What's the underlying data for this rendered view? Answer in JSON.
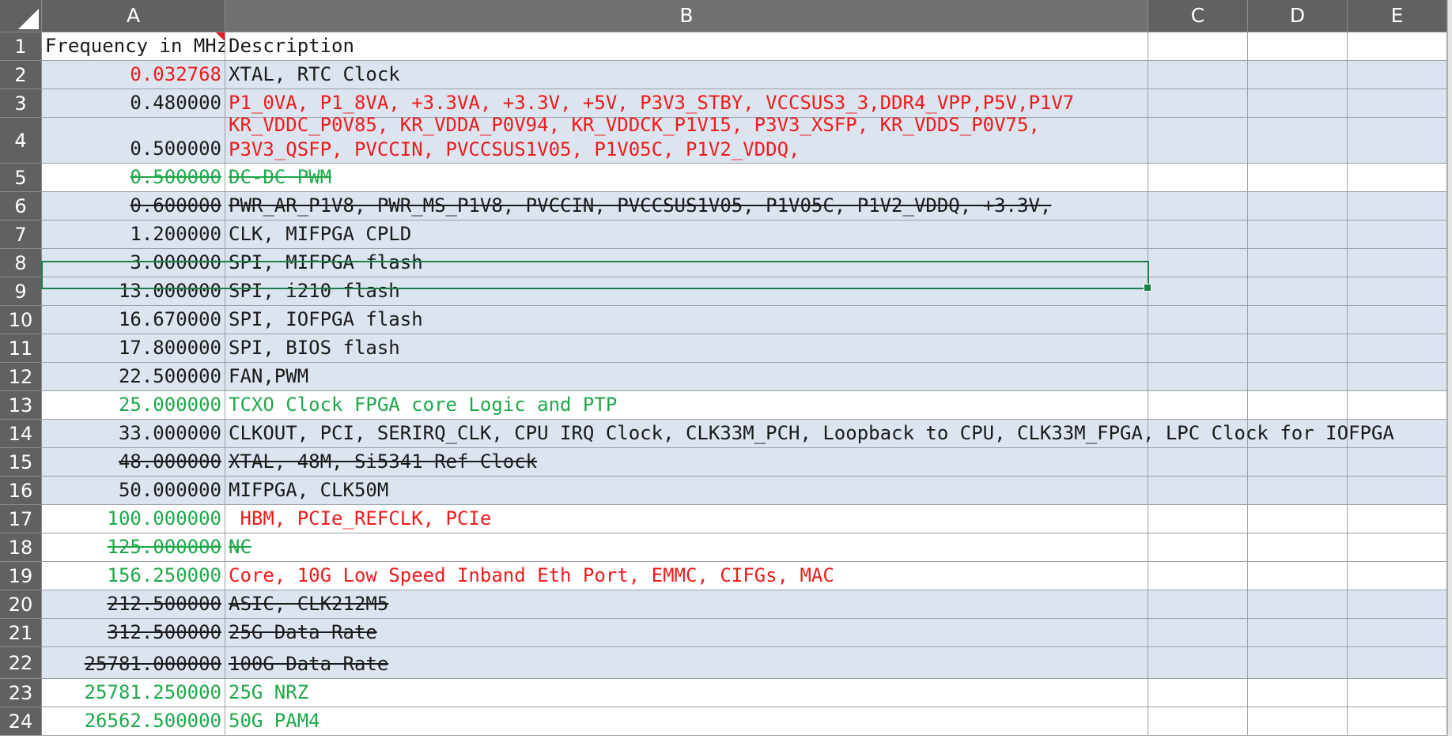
{
  "columns": {
    "A": "A",
    "B": "B",
    "C": "C",
    "D": "D",
    "E": "E"
  },
  "rows": [
    {
      "num": "1",
      "a": "Frequency in MHz",
      "b": "Description",
      "a_color": "black",
      "b_color": "black",
      "strike": false,
      "fill": false
    },
    {
      "num": "2",
      "a": "0.032768",
      "b": "XTAL, RTC Clock",
      "a_color": "red",
      "b_color": "black",
      "strike": false,
      "fill": true
    },
    {
      "num": "3",
      "a": "0.480000",
      "b": "P1_0VA, P1_8VA, +3.3VA, +3.3V, +5V, P3V3_STBY, VCCSUS3_3,DDR4_VPP,P5V,P1V7",
      "a_color": "black",
      "b_color": "red",
      "strike": false,
      "fill": true
    },
    {
      "num": "4",
      "a": "0.500000",
      "b": "KR_VDDC_P0V85, KR_VDDA_P0V94, KR_VDDCK_P1V15, P3V3_XSFP, KR_VDDS_P0V75, P3V3_QSFP, PVCCIN, PVCCSUS1V05, P1V05C, P1V2_VDDQ,",
      "a_color": "black",
      "b_color": "red",
      "strike": false,
      "fill": true
    },
    {
      "num": "5",
      "a": "0.500000",
      "b": "DC-DC PWM",
      "a_color": "green",
      "b_color": "green",
      "strike": true,
      "fill": false
    },
    {
      "num": "6",
      "a": "0.600000",
      "b": "PWR_AR_P1V8, PWR_MS_P1V8, PVCCIN, PVCCSUS1V05, P1V05C, P1V2_VDDQ, +3.3V,",
      "a_color": "black",
      "b_color": "black",
      "strike": true,
      "fill": true
    },
    {
      "num": "7",
      "a": "1.200000",
      "b": "CLK, MIFPGA CPLD",
      "a_color": "black",
      "b_color": "black",
      "strike": false,
      "fill": true
    },
    {
      "num": "8",
      "a": "3.000000",
      "b": "SPI, MIFPGA flash",
      "a_color": "black",
      "b_color": "black",
      "strike": false,
      "fill": true
    },
    {
      "num": "9",
      "a": "13.000000",
      "b": "SPI, i210 flash",
      "a_color": "black",
      "b_color": "black",
      "strike": false,
      "fill": true
    },
    {
      "num": "10",
      "a": "16.670000",
      "b": "SPI, IOFPGA flash",
      "a_color": "black",
      "b_color": "black",
      "strike": false,
      "fill": true
    },
    {
      "num": "11",
      "a": "17.800000",
      "b": "SPI, BIOS flash",
      "a_color": "black",
      "b_color": "black",
      "strike": false,
      "fill": true
    },
    {
      "num": "12",
      "a": "22.500000",
      "b": "FAN,PWM",
      "a_color": "black",
      "b_color": "black",
      "strike": false,
      "fill": true
    },
    {
      "num": "13",
      "a": "25.000000",
      "b": "TCXO Clock FPGA core Logic and PTP",
      "a_color": "green",
      "b_color": "green",
      "strike": false,
      "fill": false
    },
    {
      "num": "14",
      "a": "33.000000",
      "b": "CLKOUT, PCI, SERIRQ_CLK, CPU IRQ Clock, CLK33M_PCH, Loopback to CPU, CLK33M_FPGA, LPC Clock for IOFPGA",
      "a_color": "black",
      "b_color": "black",
      "strike": false,
      "fill": true
    },
    {
      "num": "15",
      "a": "48.000000",
      "b": "XTAL, 48M, Si5341 Ref Clock",
      "a_color": "black",
      "b_color": "black",
      "strike": true,
      "fill": true
    },
    {
      "num": "16",
      "a": "50.000000",
      "b": "MIFPGA, CLK50M",
      "a_color": "black",
      "b_color": "black",
      "strike": false,
      "fill": true
    },
    {
      "num": "17",
      "a": "100.000000",
      "b": " HBM, PCIe_REFCLK, PCIe",
      "a_color": "green",
      "b_color": "red",
      "strike": false,
      "fill": false
    },
    {
      "num": "18",
      "a": "125.000000",
      "b": "NC",
      "a_color": "green",
      "b_color": "green",
      "strike": true,
      "fill": false
    },
    {
      "num": "19",
      "a": "156.250000",
      "b": "Core, 10G Low Speed Inband Eth Port, EMMC, CIFGs, MAC",
      "a_color": "green",
      "b_color": "red",
      "strike": false,
      "fill": false
    },
    {
      "num": "20",
      "a": "212.500000",
      "b": "ASIC, CLK212M5",
      "a_color": "black",
      "b_color": "black",
      "strike": true,
      "fill": true
    },
    {
      "num": "21",
      "a": "312.500000",
      "b": "25G Data Rate",
      "a_color": "black",
      "b_color": "black",
      "strike": true,
      "fill": true
    },
    {
      "num": "22",
      "a": "25781.000000",
      "b": "100G Data Rate",
      "a_color": "black",
      "b_color": "black",
      "strike": true,
      "fill": true
    },
    {
      "num": "23",
      "a": "25781.250000",
      "b": "25G NRZ",
      "a_color": "green",
      "b_color": "green",
      "strike": false,
      "fill": false
    },
    {
      "num": "24",
      "a": "26562.500000",
      "b": "50G PAM4",
      "a_color": "green",
      "b_color": "green",
      "strike": false,
      "fill": false
    }
  ],
  "colors": {
    "header_bg": "#616161",
    "row_fill": "#dce4ef",
    "red_text": "#ee1b1b",
    "green_text": "#1ea84a",
    "selection": "#1b7f46"
  },
  "selected_cell": "B8"
}
